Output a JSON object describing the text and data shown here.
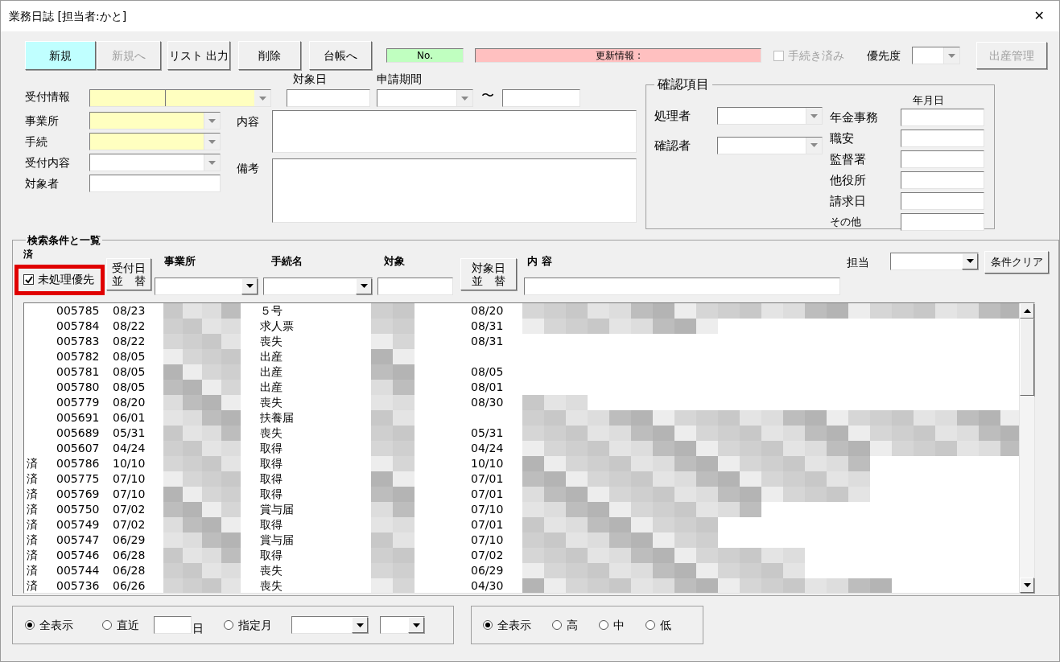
{
  "window": {
    "title": "業務日誌 [担当者:かと]",
    "close_glyph": "✕"
  },
  "toolbar": {
    "buttons": [
      {
        "label": "新規",
        "kind": "primary",
        "disabled": false
      },
      {
        "label": "新規へ",
        "kind": "normal",
        "disabled": true
      },
      {
        "label": "リスト 出力",
        "kind": "normal",
        "disabled": false
      },
      {
        "label": "削除",
        "kind": "normal",
        "disabled": false
      },
      {
        "label": "台帳へ",
        "kind": "normal",
        "disabled": false
      }
    ],
    "number_field": {
      "label": "No."
    },
    "update_info": {
      "label": "更新情報 :"
    },
    "procedure_done": {
      "label": "手続き済み",
      "checked": false,
      "disabled": true
    },
    "priority": {
      "label": "優先度"
    },
    "birth_management": {
      "label": "出産管理",
      "disabled": true
    }
  },
  "entry": {
    "reception": {
      "label": "受付情報",
      "required": true
    },
    "target_date": {
      "label": "対象日"
    },
    "application_period": {
      "label": "申請期間",
      "separator": "〜"
    },
    "fields": [
      {
        "label": "事業所",
        "kind": "combo",
        "required": true
      },
      {
        "label": "手続",
        "kind": "combo",
        "required": true
      },
      {
        "label": "受付内容",
        "kind": "combo",
        "required": false
      },
      {
        "label": "対象者",
        "kind": "text",
        "required": false
      }
    ],
    "content": {
      "label": "内容"
    },
    "remarks": {
      "label": "備考"
    }
  },
  "confirmation": {
    "title": "確認項目",
    "people": [
      {
        "label": "処理者"
      },
      {
        "label": "確認者"
      }
    ],
    "date_header": "年月日",
    "dates": [
      {
        "label": "年金事務"
      },
      {
        "label": "職安"
      },
      {
        "label": "監督署"
      },
      {
        "label": "他役所"
      },
      {
        "label": "請求日"
      },
      {
        "label": "その他"
      }
    ]
  },
  "search": {
    "title": "検索条件と一覧",
    "done_header": "済",
    "unprocessed_first": {
      "label": "未処理優先",
      "checked": true,
      "highlighted": true
    },
    "sort_received": {
      "lines": [
        "受付日",
        "並　替"
      ]
    },
    "office_label": "事業所",
    "procedure_label": "手続名",
    "target_label": "対象",
    "sort_target": {
      "lines": [
        "対象日",
        "並　替"
      ]
    },
    "content_label": "内 容",
    "staff_label": "担当",
    "clear_button": "条件クリア",
    "rows": [
      {
        "no": "005785",
        "received": "08/23",
        "procedure": "５号",
        "target_date": "08/20"
      },
      {
        "no": "005784",
        "received": "08/22",
        "procedure": "求人票",
        "target_date": "08/31"
      },
      {
        "no": "005783",
        "received": "08/22",
        "procedure": "喪失",
        "target_date": "08/31"
      },
      {
        "no": "005782",
        "received": "08/05",
        "procedure": "出産"
      },
      {
        "no": "005781",
        "received": "08/05",
        "procedure": "出産",
        "target_date": "08/05"
      },
      {
        "no": "005780",
        "received": "08/05",
        "procedure": "出産",
        "target_date": "08/01"
      },
      {
        "no": "005779",
        "received": "08/20",
        "procedure": "喪失",
        "target_date": "08/30"
      },
      {
        "no": "005691",
        "received": "06/01",
        "procedure": "扶養届"
      },
      {
        "no": "005689",
        "received": "05/31",
        "procedure": "喪失",
        "target_date": "05/31"
      },
      {
        "no": "005607",
        "received": "04/24",
        "procedure": "取得",
        "target_date": "04/24"
      },
      {
        "status": "済",
        "no": "005786",
        "received": "10/10",
        "procedure": "取得",
        "target_date": "10/10"
      },
      {
        "status": "済",
        "no": "005775",
        "received": "07/10",
        "procedure": "取得",
        "target_date": "07/01"
      },
      {
        "status": "済",
        "no": "005769",
        "received": "07/10",
        "procedure": "取得",
        "target_date": "07/01"
      },
      {
        "status": "済",
        "no": "005750",
        "received": "07/02",
        "procedure": "賞与届",
        "target_date": "07/10"
      },
      {
        "status": "済",
        "no": "005749",
        "received": "07/02",
        "procedure": "取得",
        "target_date": "07/01"
      },
      {
        "status": "済",
        "no": "005747",
        "received": "06/29",
        "procedure": "賞与届",
        "target_date": "07/10"
      },
      {
        "status": "済",
        "no": "005746",
        "received": "06/28",
        "procedure": "取得",
        "target_date": "07/02"
      },
      {
        "status": "済",
        "no": "005744",
        "received": "06/28",
        "procedure": "喪失",
        "target_date": "06/29"
      },
      {
        "status": "済",
        "no": "005736",
        "received": "06/26",
        "procedure": "喪失",
        "target_date": "04/30"
      }
    ]
  },
  "period_filter": {
    "options": [
      {
        "label": "全表示",
        "selected": true
      },
      {
        "label": "直近",
        "selected": false
      },
      {
        "label": "指定月",
        "selected": false
      }
    ],
    "days_unit": "日"
  },
  "priority_filter": {
    "options": [
      {
        "label": "全表示",
        "selected": true
      },
      {
        "label": "高",
        "selected": false
      },
      {
        "label": "中",
        "selected": false
      },
      {
        "label": "低",
        "selected": false
      }
    ]
  }
}
